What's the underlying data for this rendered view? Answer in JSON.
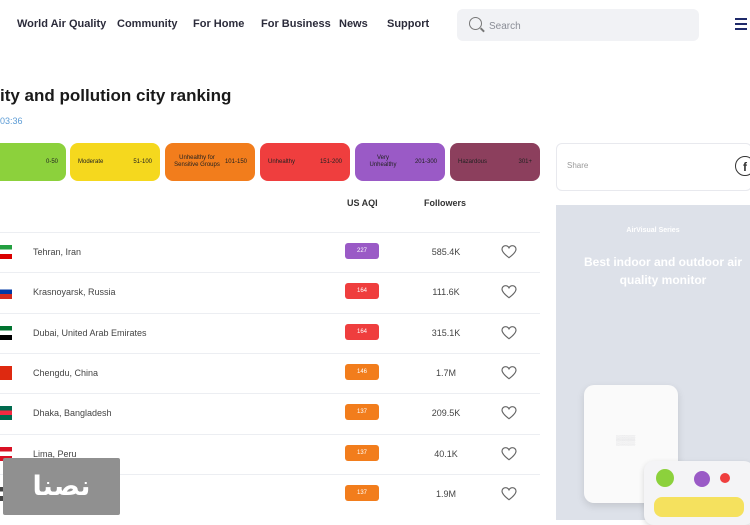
{
  "nav": {
    "items": [
      "World Air Quality",
      "Community",
      "For Home",
      "For Business",
      "News",
      "Support"
    ],
    "search_placeholder": "Search"
  },
  "page": {
    "title": "ity and pollution city ranking",
    "subtitle": "03:36"
  },
  "legend": [
    {
      "label": "",
      "range": "0-50",
      "color": "#8cd13c"
    },
    {
      "label": "Moderate",
      "range": "51-100",
      "color": "#f5d81e"
    },
    {
      "label": "Unhealthy for Sensitive Groups",
      "range": "101-150",
      "color": "#f27d1c"
    },
    {
      "label": "Unhealthy",
      "range": "151-200",
      "color": "#ef3e3e"
    },
    {
      "label": "Very Unhealthy",
      "range": "201-300",
      "color": "#9a5ac6"
    },
    {
      "label": "Hazardous",
      "range": "301+",
      "color": "#8c3f5d"
    }
  ],
  "table": {
    "columns": {
      "aqi": "US AQI",
      "followers": "Followers"
    },
    "rows": [
      {
        "city": "Tehran, Iran",
        "aqi": "227",
        "aqi_color": "#9a5ac6",
        "followers": "585.4K",
        "flag": [
          "#239f40",
          "#ffffff",
          "#da0000"
        ]
      },
      {
        "city": "Krasnoyarsk, Russia",
        "aqi": "164",
        "aqi_color": "#ef3e3e",
        "followers": "111.6K",
        "flag": [
          "#ffffff",
          "#0039a6",
          "#d52b1e"
        ]
      },
      {
        "city": "Dubai, United Arab Emirates",
        "aqi": "164",
        "aqi_color": "#ef3e3e",
        "followers": "315.1K",
        "flag": [
          "#00732f",
          "#ffffff",
          "#000000"
        ]
      },
      {
        "city": "Chengdu, China",
        "aqi": "146",
        "aqi_color": "#f27d1c",
        "followers": "1.7M",
        "flag": [
          "#de2910",
          "#de2910",
          "#de2910"
        ]
      },
      {
        "city": "Dhaka, Bangladesh",
        "aqi": "137",
        "aqi_color": "#f27d1c",
        "followers": "209.5K",
        "flag": [
          "#006a4e",
          "#f42a41",
          "#006a4e"
        ]
      },
      {
        "city": "Lima, Peru",
        "aqi": "137",
        "aqi_color": "#f27d1c",
        "followers": "40.1K",
        "flag": [
          "#d91023",
          "#ffffff",
          "#d91023"
        ]
      },
      {
        "city": "",
        "aqi": "137",
        "aqi_color": "#f27d1c",
        "followers": "1.9M",
        "flag": [
          "#444444",
          "#ffffff",
          "#444444"
        ]
      }
    ]
  },
  "share": {
    "label": "Share"
  },
  "ad": {
    "kicker": "AirVisual Series",
    "headline": "Best indoor and outdoor air quality monitor"
  },
  "watermark": {
    "text": "نصنا"
  }
}
